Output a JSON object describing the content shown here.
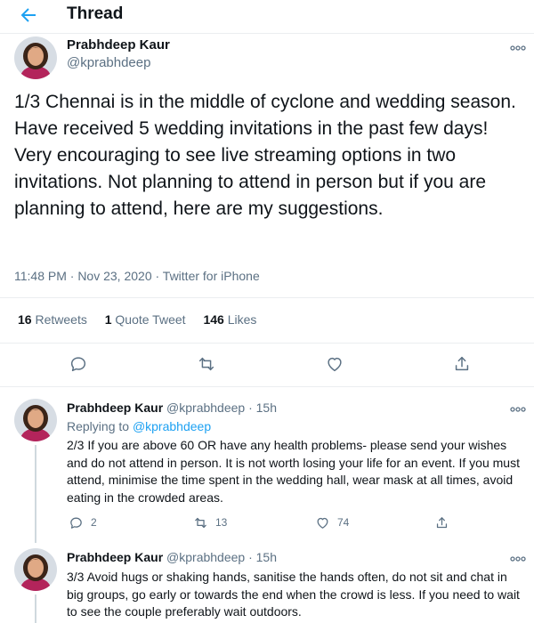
{
  "header": {
    "title": "Thread"
  },
  "main_tweet": {
    "author_name": "Prabhdeep Kaur",
    "handle": "@kprabhdeep",
    "text": "1/3 Chennai is in the middle of cyclone and wedding season. Have received 5 wedding invitations in the past few days! Very encouraging to see live streaming options in two invitations. Not planning to attend in person but if you are planning to attend, here are my suggestions.",
    "meta": "11:48 PM · Nov 23, 2020 · Twitter for iPhone",
    "stats": {
      "retweets_count": "16",
      "retweets_label": "Retweets",
      "quotes_count": "1",
      "quotes_label": "Quote Tweet",
      "likes_count": "146",
      "likes_label": "Likes"
    }
  },
  "replies": [
    {
      "author_name": "Prabhdeep Kaur",
      "handle_time": "@kprabhdeep · 15h",
      "replying_label": "Replying to",
      "replying_handle": "@kprabhdeep",
      "text": "2/3 If you are above 60 OR have any health problems- please send your wishes and do not attend in person. It is not worth losing your life for an event. If you must attend, minimise the time spent in the wedding hall, wear mask at all times, avoid eating in the crowded areas.",
      "reply_count": "2",
      "retweet_count": "13",
      "like_count": "74"
    },
    {
      "author_name": "Prabhdeep Kaur",
      "handle_time": "@kprabhdeep · 15h",
      "text": "3/3 Avoid hugs or shaking hands, sanitise the hands often, do not sit and chat in big groups, go early or towards the end when the crowd is less. If you need to wait to see the couple preferably wait outdoors."
    }
  ],
  "colors": {
    "accent": "#1da1f2",
    "muted": "#5b7083",
    "border": "#ebeef0"
  },
  "icons": [
    "back-arrow-icon",
    "more-icon",
    "reply-icon",
    "retweet-icon",
    "like-icon",
    "share-icon"
  ]
}
